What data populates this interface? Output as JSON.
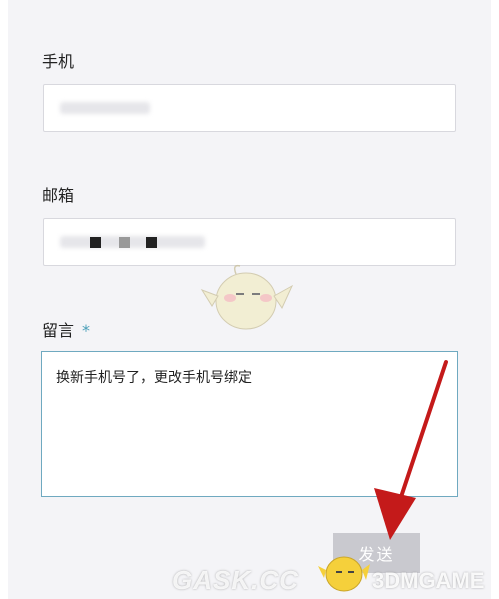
{
  "form": {
    "phone": {
      "label": "手机"
    },
    "email": {
      "label": "邮箱"
    },
    "message": {
      "label": "留言",
      "required_mark": "*",
      "value": "换新手机号了，更改手机号绑定"
    },
    "submit_label": "发送"
  },
  "watermark": {
    "left_text": "GASK.CC",
    "right_text": "3DMGAME"
  },
  "colors": {
    "panel_bg": "#f4f4f7",
    "accent_border": "#6fa9c0",
    "required": "#4a9fb8",
    "button_disabled": "#c9c9cf",
    "annotation_arrow": "#c41a1a"
  },
  "icons": {
    "arrow": "red-arrow-annotation-icon",
    "mascot": "mascot-watermark-icon"
  }
}
